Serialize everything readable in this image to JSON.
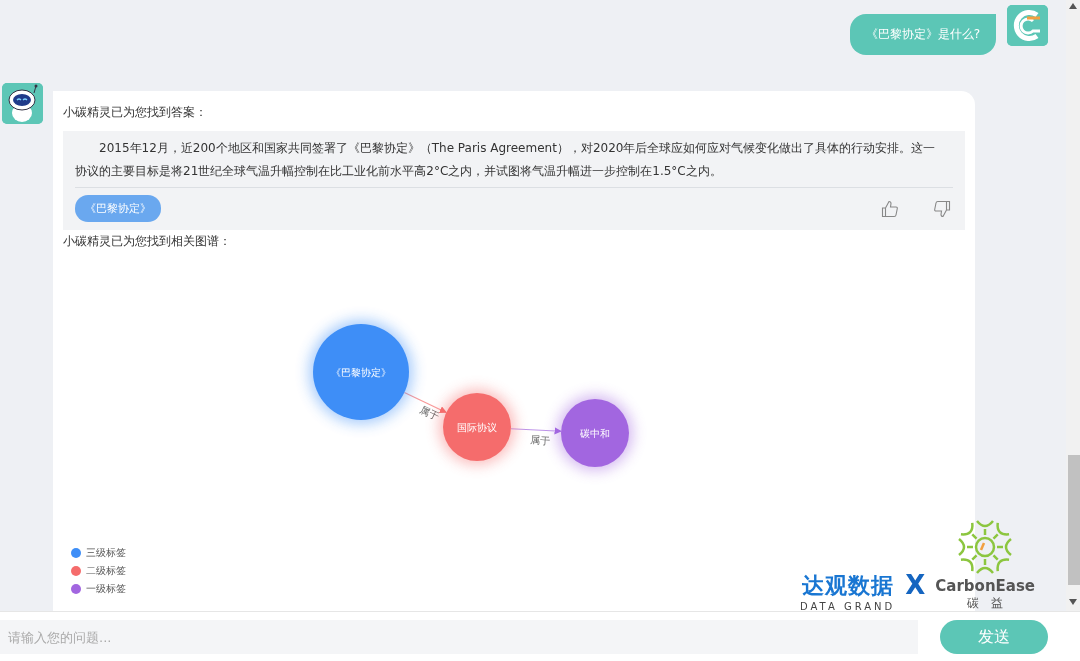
{
  "user_message": {
    "text": "《巴黎协定》是什么?"
  },
  "bot_reply": {
    "intro": "小碳精灵已为您找到答案：",
    "answer": "2015年12月，近200个地区和国家共同签署了《巴黎协定》（The Paris Agreement），对2020年后全球应如何应对气候变化做出了具体的行动安排。这一协议的主要目标是将21世纪全球气温升幅控制在比工业化前水平高2°C之内，并试图将气温升幅进一步控制在1.5°C之内。",
    "tags": [
      {
        "label": "《巴黎协定》"
      }
    ],
    "graph_intro": "小碳精灵已为您找到相关图谱："
  },
  "graph": {
    "nodes": [
      {
        "label": "《巴黎协定》",
        "color": "#3e8ef7",
        "link_label": "属于"
      },
      {
        "label": "国际协议",
        "color": "#f56c6c",
        "link_label": "属于"
      },
      {
        "label": "碳中和",
        "color": "#a266e0"
      }
    ],
    "legend": [
      {
        "label": "三级标签",
        "color": "#3e8ef7"
      },
      {
        "label": "二级标签",
        "color": "#f56c6c"
      },
      {
        "label": "一级标签",
        "color": "#a266e0"
      }
    ]
  },
  "logos": {
    "partner_name": "达观数据",
    "partner_subtitle": "DATA GRAND",
    "separator": "X",
    "brand": "CarbonEase",
    "brand_subtitle": "碳　益"
  },
  "input": {
    "placeholder": "请输入您的问题...",
    "send_label": "发送"
  }
}
